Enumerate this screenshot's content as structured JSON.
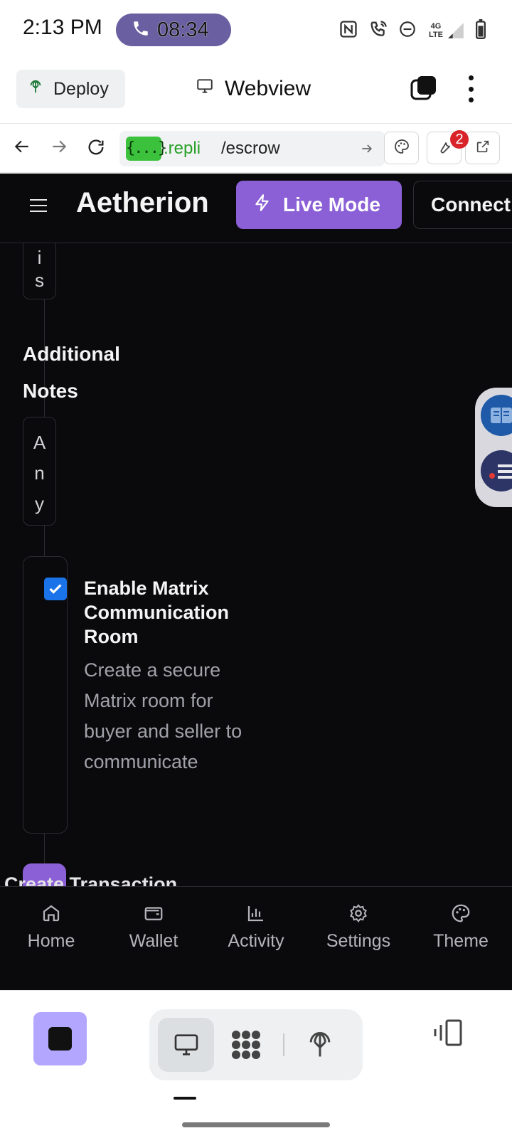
{
  "status_bar": {
    "time": "2:13 PM",
    "call_timer": "08:34",
    "network": "4G LTE"
  },
  "top_bar": {
    "deploy_label": "Deploy",
    "title": "Webview"
  },
  "url_bar": {
    "badge": "{...}",
    "host": ".repli",
    "path": "/escrow",
    "devtools_badge_count": "2"
  },
  "app": {
    "brand": "Aetherion",
    "live_mode_label": "Live Mode",
    "connect_label": "Connect",
    "field_stub_chars": [
      "i",
      "s"
    ],
    "notes_label": "Additional Notes",
    "notes_placeholder_chars": [
      "A",
      "n",
      "y"
    ],
    "matrix": {
      "checked": true,
      "title": "Enable Matrix Communication Room",
      "description": "Create a secure Matrix room for buyer and seller to communicate"
    },
    "create_label_partial": "Create Transaction",
    "accent_color": "#8b60d6",
    "bottom_nav": [
      {
        "label": "Home",
        "icon": "home-icon"
      },
      {
        "label": "Wallet",
        "icon": "wallet-icon"
      },
      {
        "label": "Activity",
        "icon": "activity-icon"
      },
      {
        "label": "Settings",
        "icon": "settings-icon"
      },
      {
        "label": "Theme",
        "icon": "palette-icon"
      }
    ]
  }
}
